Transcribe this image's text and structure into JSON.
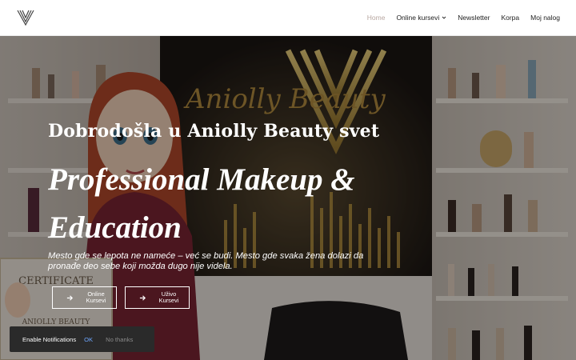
{
  "header": {
    "logo_icon": "v-monogram-logo-icon",
    "nav": [
      {
        "label": "Home",
        "active": true
      },
      {
        "label": "Online kursevi",
        "has_dropdown": true
      },
      {
        "label": "Newsletter"
      },
      {
        "label": "Korpa"
      },
      {
        "label": "Moj nalog"
      }
    ]
  },
  "hero": {
    "welcome": "Dobrodošla u Aniolly Beauty svet",
    "headline": "Professional Makeup & Education",
    "description": "Mesto gde se lepota ne nameće – već se budi. Mesto gde svaka žena dolazi da pronađe deo sebe koji možda dugo nije videla.",
    "buttons": [
      {
        "label": "Online Kursevi",
        "icon": "arrow-right-icon"
      },
      {
        "label": "Uživo Kursevi",
        "icon": "arrow-right-icon"
      }
    ],
    "background": {
      "wall_sign_text": "Aniolly Beauty",
      "certificate_text": [
        "CERTIFICATE",
        "ANIOLLY BEAUTY"
      ]
    }
  },
  "notification": {
    "text": "Enable Notifications",
    "ok_label": "OK",
    "dismiss_label": "No thanks",
    "ok_color": "#6fa8ff"
  },
  "colors": {
    "active_nav": "#b8a7a0",
    "accent_gold": "#c9a24a"
  }
}
